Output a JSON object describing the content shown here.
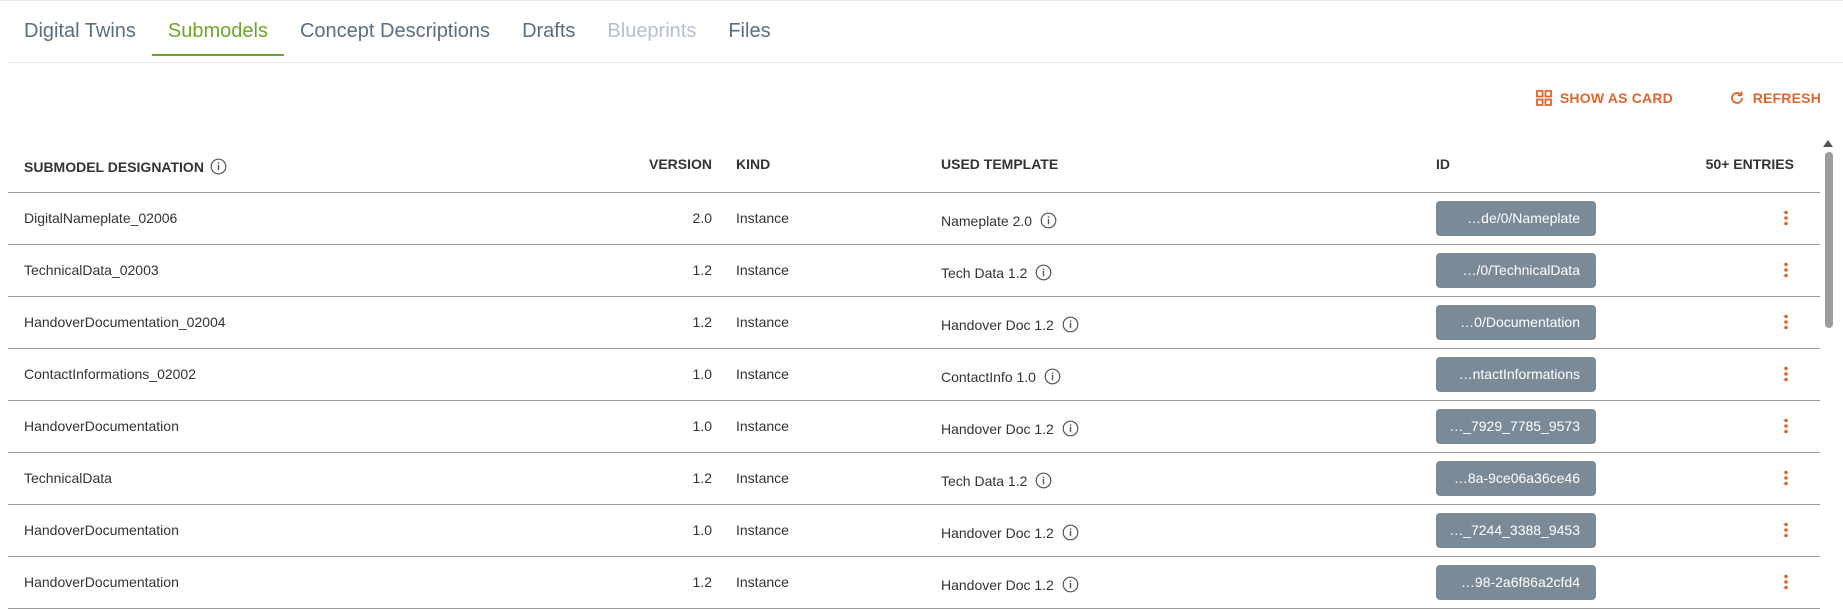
{
  "tabs": [
    {
      "label": "Digital Twins",
      "state": "normal"
    },
    {
      "label": "Submodels",
      "state": "active"
    },
    {
      "label": "Concept Descriptions",
      "state": "normal"
    },
    {
      "label": "Drafts",
      "state": "normal"
    },
    {
      "label": "Blueprints",
      "state": "disabled"
    },
    {
      "label": "Files",
      "state": "normal"
    }
  ],
  "toolbar": {
    "show_as_card": "SHOW AS CARD",
    "refresh": "REFRESH"
  },
  "table": {
    "headers": {
      "designation": "SUBMODEL DESIGNATION",
      "version": "VERSION",
      "kind": "KIND",
      "template": "USED TEMPLATE",
      "id": "ID",
      "entries": "50+ ENTRIES"
    },
    "rows": [
      {
        "designation": "DigitalNameplate_02006",
        "version": "2.0",
        "kind": "Instance",
        "template": "Nameplate 2.0",
        "id": "…de/0/Nameplate"
      },
      {
        "designation": "TechnicalData_02003",
        "version": "1.2",
        "kind": "Instance",
        "template": "Tech Data 1.2",
        "id": "…/0/TechnicalData"
      },
      {
        "designation": "HandoverDocumentation_02004",
        "version": "1.2",
        "kind": "Instance",
        "template": "Handover Doc 1.2",
        "id": "…0/Documentation"
      },
      {
        "designation": "ContactInformations_02002",
        "version": "1.0",
        "kind": "Instance",
        "template": "ContactInfo 1.0",
        "id": "…ntactInformations"
      },
      {
        "designation": "HandoverDocumentation",
        "version": "1.0",
        "kind": "Instance",
        "template": "Handover Doc 1.2",
        "id": "…_7929_7785_9573"
      },
      {
        "designation": "TechnicalData",
        "version": "1.2",
        "kind": "Instance",
        "template": "Tech Data 1.2",
        "id": "…8a-9ce06a36ce46"
      },
      {
        "designation": "HandoverDocumentation",
        "version": "1.0",
        "kind": "Instance",
        "template": "Handover Doc 1.2",
        "id": "…_7244_3388_9453"
      },
      {
        "designation": "HandoverDocumentation",
        "version": "1.2",
        "kind": "Instance",
        "template": "Handover Doc 1.2",
        "id": "…98-2a6f86a2cfd4"
      }
    ]
  },
  "colors": {
    "accent_active": "#6ea524",
    "action_orange": "#e0652a",
    "id_chip": "#7a8a96"
  },
  "icons": {
    "show_as_card": "grid-icon",
    "refresh": "refresh-icon",
    "info": "info-icon",
    "row_menu": "more-vertical-icon"
  }
}
